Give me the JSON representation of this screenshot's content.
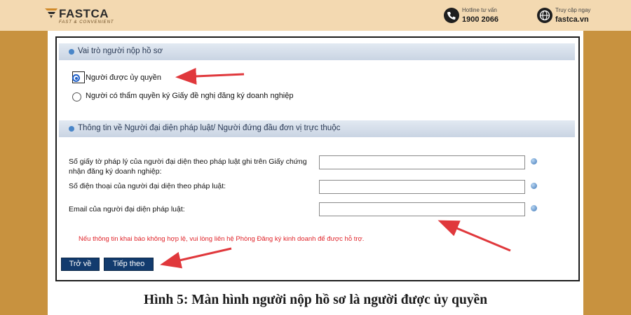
{
  "header": {
    "brand": "FASTCA",
    "tagline": "FAST & CONVENIENT",
    "hotline_label": "Hotline tư vấn",
    "hotline_value": "1900 2066",
    "site_label": "Truy cập ngay",
    "site_value": "fastca.vn"
  },
  "form": {
    "section1_title": "Vai trò người nộp hồ sơ",
    "role_options": [
      {
        "label": "Người được ủy quyền",
        "selected": true
      },
      {
        "label": "Người có thẩm quyền ký Giấy đề nghị đăng ký doanh nghiệp",
        "selected": false
      }
    ],
    "section2_title": "Thông tin về Người đại diện pháp luật/ Người đứng đầu đơn vị trực thuộc",
    "fields": [
      {
        "label": "Số giấy tờ pháp lý của người đại diện theo pháp luật ghi trên Giấy chứng nhận đăng ký doanh nghiệp:",
        "value": ""
      },
      {
        "label": "Số điện thoại của người đại diện theo pháp luật:",
        "value": ""
      },
      {
        "label": "Email của người đại diện pháp luật:",
        "value": ""
      }
    ],
    "notice": "Nếu thông tin khai báo không hợp lệ, vui lòng liên hệ Phòng Đăng ký kinh doanh để được hỗ trợ.",
    "back_button": "Trở về",
    "next_button": "Tiếp theo"
  },
  "caption": "Hình 5: Màn hình người nộp hồ sơ là người được ủy quyền",
  "colors": {
    "background": "#c8923f",
    "topbar": "#f3d9b1",
    "button": "#123b6e",
    "notice": "#e0242a",
    "arrow": "#e0383c"
  }
}
